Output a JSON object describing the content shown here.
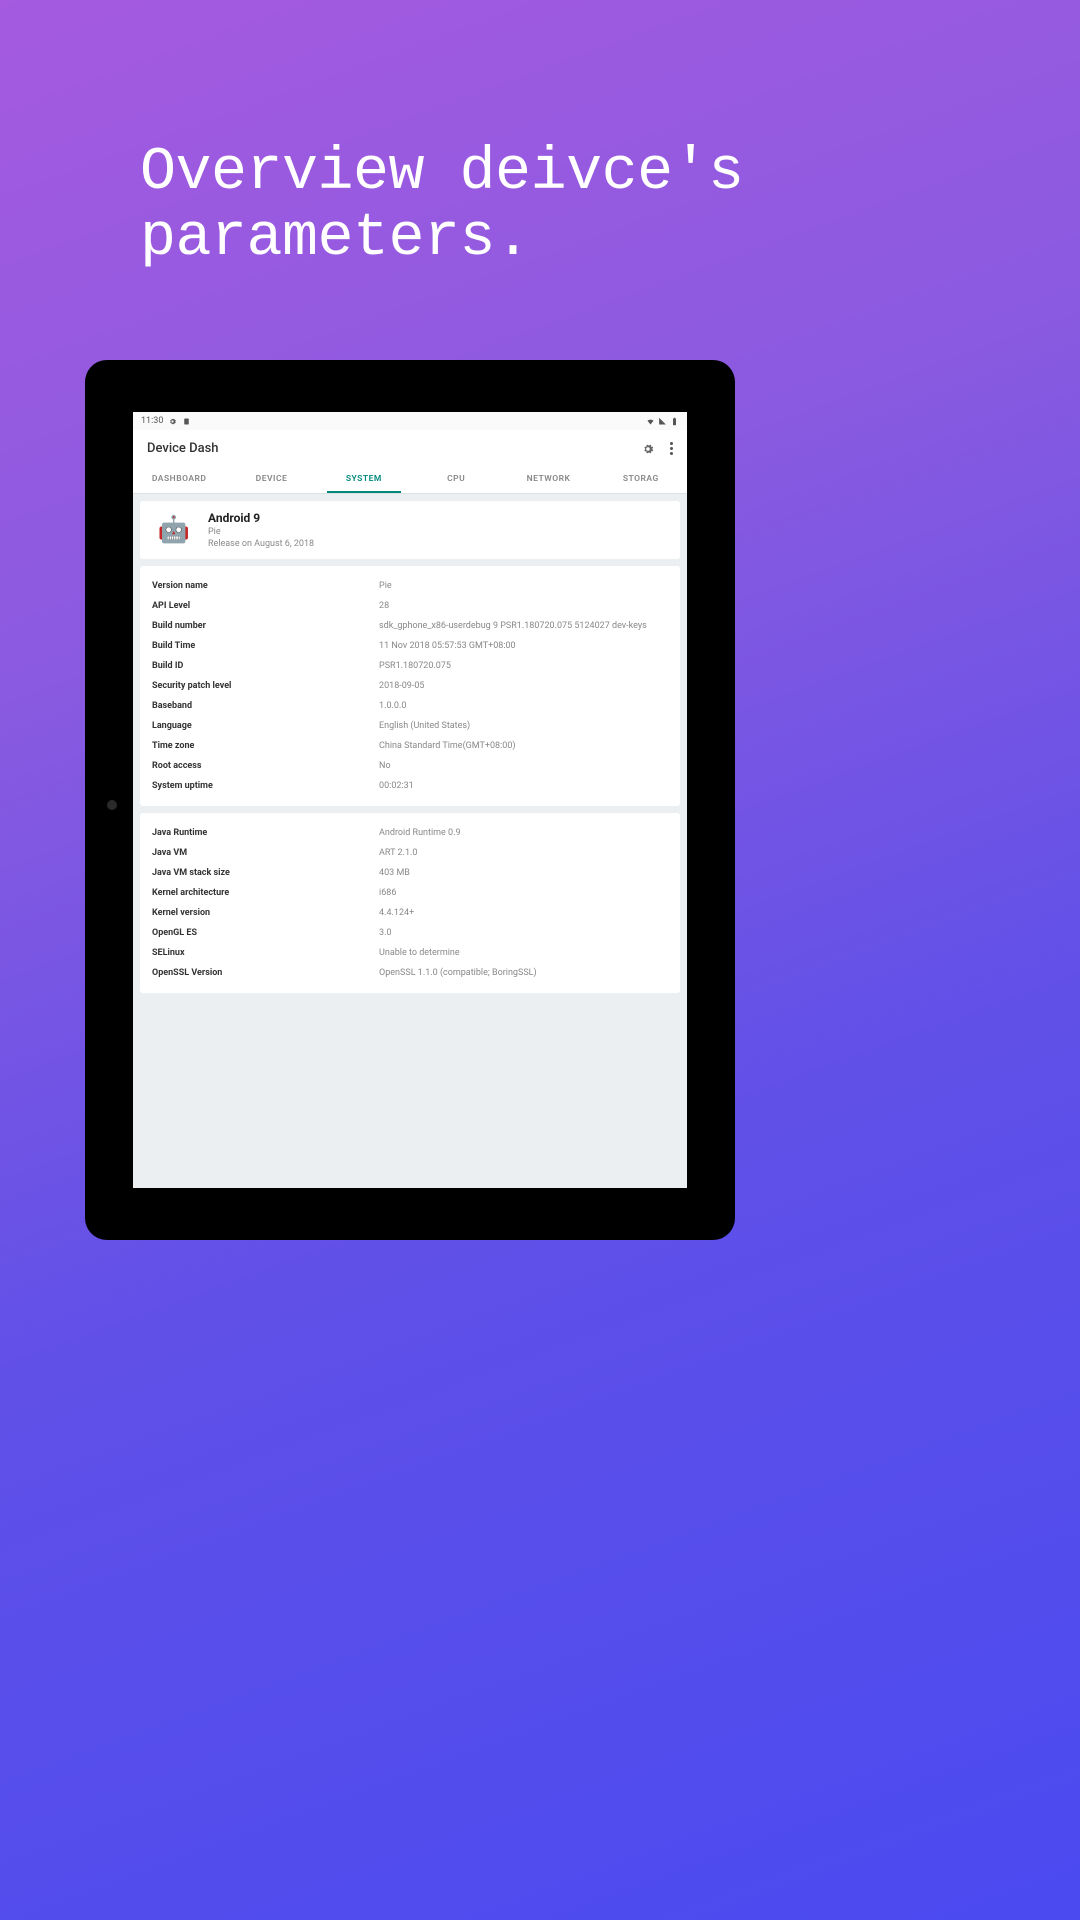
{
  "headline": "Overview deivce's parameters.",
  "status": {
    "time": "11:30"
  },
  "app": {
    "title": "Device Dash"
  },
  "tabs": [
    "DASHBOARD",
    "DEVICE",
    "SYSTEM",
    "CPU",
    "NETWORK",
    "STORAG"
  ],
  "active_tab_index": 2,
  "os": {
    "title": "Android 9",
    "codename": "Pie",
    "release": "Release on August 6, 2018"
  },
  "group1": [
    {
      "k": "Version name",
      "v": "Pie"
    },
    {
      "k": "API Level",
      "v": "28"
    },
    {
      "k": "Build number",
      "v": "sdk_gphone_x86-userdebug 9 PSR1.180720.075 5124027 dev-keys"
    },
    {
      "k": "Build Time",
      "v": "11 Nov 2018 05:57:53 GMT+08:00"
    },
    {
      "k": "Build ID",
      "v": "PSR1.180720.075"
    },
    {
      "k": "Security patch level",
      "v": "2018-09-05"
    },
    {
      "k": "Baseband",
      "v": "1.0.0.0"
    },
    {
      "k": "Language",
      "v": "English (United States)"
    },
    {
      "k": "Time zone",
      "v": "China Standard Time(GMT+08:00)"
    },
    {
      "k": "Root access",
      "v": "No"
    },
    {
      "k": "System uptime",
      "v": "00:02:31"
    }
  ],
  "group2": [
    {
      "k": "Java Runtime",
      "v": "Android Runtime 0.9"
    },
    {
      "k": "Java VM",
      "v": "ART 2.1.0"
    },
    {
      "k": "Java VM stack size",
      "v": "403 MB"
    },
    {
      "k": "Kernel architecture",
      "v": "i686"
    },
    {
      "k": "Kernel version",
      "v": "4.4.124+"
    },
    {
      "k": "OpenGL ES",
      "v": "3.0"
    },
    {
      "k": "SELinux",
      "v": "Unable to determine"
    },
    {
      "k": "OpenSSL Version",
      "v": "OpenSSL 1.1.0 (compatible; BoringSSL)"
    }
  ]
}
